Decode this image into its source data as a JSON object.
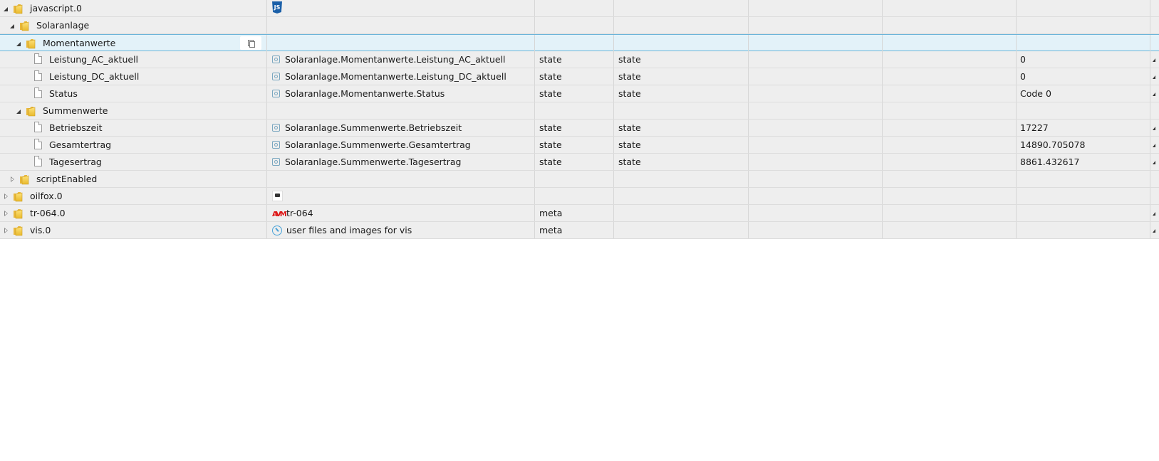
{
  "tree": {
    "rows": [
      {
        "name": "javascript.0",
        "type": "folder",
        "expand": "open",
        "id_text": "",
        "icon": "javascript-js-icon",
        "col_type": "",
        "col_role": "",
        "value": "",
        "selected": false,
        "edge": false
      },
      {
        "name": "Solaranlage",
        "type": "folder",
        "expand": "open",
        "id_text": "",
        "icon": "",
        "col_type": "",
        "col_role": "",
        "value": "",
        "selected": false,
        "edge": false
      },
      {
        "name": "Momentanwerte",
        "type": "folder",
        "expand": "open",
        "id_text": "",
        "icon": "",
        "col_type": "",
        "col_role": "",
        "value": "",
        "selected": true,
        "edge": false
      },
      {
        "name": "Leistung_AC_aktuell",
        "type": "state",
        "expand": "",
        "id_text": "Solaranlage.Momentanwerte.Leistung_AC_aktuell",
        "icon": "state-icon",
        "col_type": "state",
        "col_role": "state",
        "value": "0",
        "selected": false,
        "edge": true
      },
      {
        "name": "Leistung_DC_aktuell",
        "type": "state",
        "expand": "",
        "id_text": "Solaranlage.Momentanwerte.Leistung_DC_aktuell",
        "icon": "state-icon",
        "col_type": "state",
        "col_role": "state",
        "value": "0",
        "selected": false,
        "edge": true
      },
      {
        "name": "Status",
        "type": "state",
        "expand": "",
        "id_text": "Solaranlage.Momentanwerte.Status",
        "icon": "state-icon",
        "col_type": "state",
        "col_role": "state",
        "value": "Code 0",
        "selected": false,
        "edge": true
      },
      {
        "name": "Summenwerte",
        "type": "folder",
        "expand": "open",
        "id_text": "",
        "icon": "",
        "col_type": "",
        "col_role": "",
        "value": "",
        "selected": false,
        "edge": false
      },
      {
        "name": "Betriebszeit",
        "type": "state",
        "expand": "",
        "id_text": "Solaranlage.Summenwerte.Betriebszeit",
        "icon": "state-icon",
        "col_type": "state",
        "col_role": "state",
        "value": "17227",
        "selected": false,
        "edge": true
      },
      {
        "name": "Gesamtertrag",
        "type": "state",
        "expand": "",
        "id_text": "Solaranlage.Summenwerte.Gesamtertrag",
        "icon": "state-icon",
        "col_type": "state",
        "col_role": "state",
        "value": "14890.705078",
        "selected": false,
        "edge": true
      },
      {
        "name": "Tagesertrag",
        "type": "state",
        "expand": "",
        "id_text": "Solaranlage.Summenwerte.Tagesertrag",
        "icon": "state-icon",
        "col_type": "state",
        "col_role": "state",
        "value": "8861.432617",
        "selected": false,
        "edge": true
      },
      {
        "name": "scriptEnabled",
        "type": "folder",
        "expand": "closed",
        "id_text": "",
        "icon": "",
        "col_type": "",
        "col_role": "",
        "value": "",
        "selected": false,
        "edge": false
      },
      {
        "name": "oilfox.0",
        "type": "folder",
        "expand": "closed",
        "id_text": "",
        "icon": "oilfox-icon",
        "col_type": "",
        "col_role": "",
        "value": "",
        "selected": false,
        "edge": false
      },
      {
        "name": "tr-064.0",
        "type": "folder",
        "expand": "closed",
        "id_text": "tr-064",
        "icon": "tr064-icon",
        "col_type": "meta",
        "col_role": "",
        "value": "",
        "selected": false,
        "edge": true
      },
      {
        "name": "vis.0",
        "type": "folder",
        "expand": "closed",
        "id_text": "user files and images for vis",
        "icon": "vis-icon",
        "col_type": "meta",
        "col_role": "",
        "value": "",
        "selected": false,
        "edge": true
      }
    ],
    "js_icon_text": "JS",
    "tr064_icon_text": "AVM"
  }
}
